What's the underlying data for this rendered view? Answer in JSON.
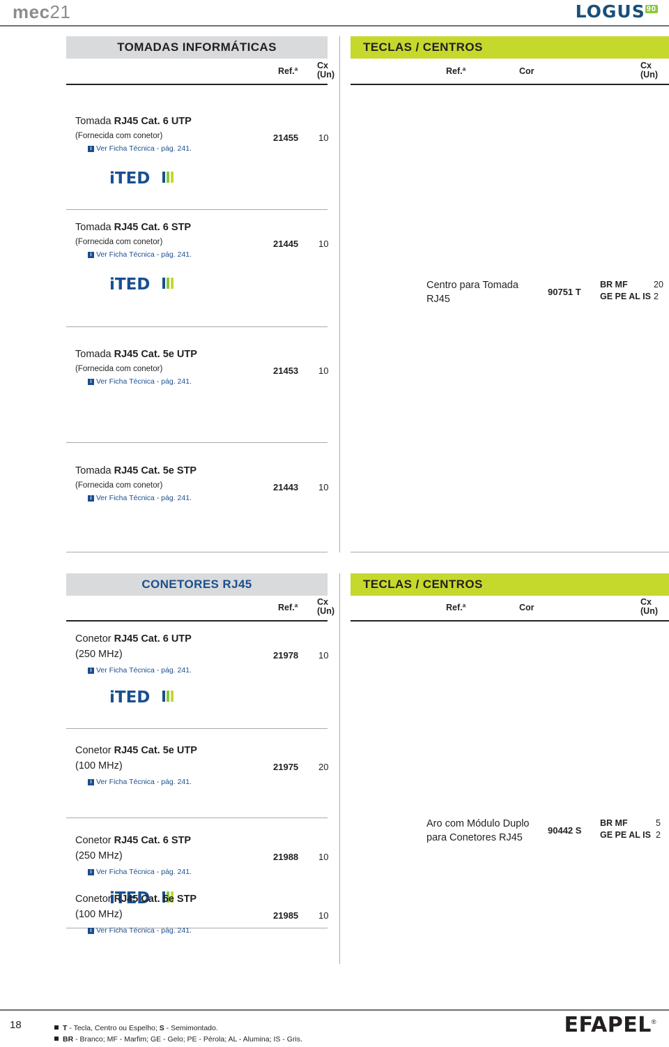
{
  "header": {
    "brand_mec": "mec",
    "brand_mec_num": "21",
    "logus": "LOGUS",
    "logus_sup": "90"
  },
  "sections": [
    {
      "id": "tomadas-informaticas",
      "title": "TOMADAS INFORMÁTICAS",
      "columns": {
        "ref": "Ref.ª",
        "cx": "Cx",
        "un": "(Un)"
      },
      "items": [
        {
          "title_plain": "Tomada ",
          "title_bold": "RJ45 Cat. 6 UTP",
          "sub": "(Fornecida com conetor)",
          "ficha": "Ver Ficha Técnica - pág. 241.",
          "ref": "21455",
          "qty": "10",
          "logo": "ited"
        },
        {
          "title_plain": "Tomada ",
          "title_bold": "RJ45 Cat. 6 STP",
          "sub": "(Fornecida com conetor)",
          "ficha": "Ver Ficha Técnica - pág. 241.",
          "ref": "21445",
          "qty": "10",
          "logo": "ited"
        },
        {
          "title_plain": "Tomada ",
          "title_bold": "RJ45 Cat. 5e UTP",
          "sub": "(Fornecida com conetor)",
          "ficha": "Ver Ficha Técnica - pág. 241.",
          "ref": "21453",
          "qty": "10",
          "logo": "none"
        },
        {
          "title_plain": "Tomada ",
          "title_bold": "RJ45 Cat. 5e STP",
          "sub": "(Fornecida com conetor)",
          "ficha": "Ver Ficha Técnica - pág. 241.",
          "ref": "21443",
          "qty": "10",
          "logo": "none"
        }
      ]
    },
    {
      "id": "conetores-rj45",
      "title": "CONETORES RJ45",
      "columns": {
        "ref": "Ref.ª",
        "cx": "Cx",
        "un": "(Un)"
      },
      "items": [
        {
          "title_plain": "Conetor ",
          "title_bold": "RJ45 Cat. 6 UTP",
          "sub": "(250 MHz)",
          "ficha": "Ver Ficha Técnica - pág. 241.",
          "ref": "21978",
          "qty": "10",
          "logo": "ited"
        },
        {
          "title_plain": "Conetor ",
          "title_bold": "RJ45 Cat. 5e UTP",
          "sub": "(100 MHz)",
          "ficha": "Ver Ficha Técnica - pág. 241.",
          "ref": "21975",
          "qty": "20",
          "logo": "none"
        },
        {
          "title_plain": "Conetor ",
          "title_bold": "RJ45 Cat. 6 STP",
          "sub": "(250 MHz)",
          "ficha": "Ver Ficha Técnica - pág. 241.",
          "ref": "21988",
          "qty": "10",
          "logo": "ited"
        },
        {
          "title_plain": "Conetor ",
          "title_bold": "RJ45 Cat. 5e STP",
          "sub": "(100 MHz)",
          "ficha": "Ver Ficha Técnica - pág. 241.",
          "ref": "21985",
          "qty": "10",
          "logo": "none"
        }
      ]
    }
  ],
  "right_sections": [
    {
      "id": "teclas-centros-top",
      "title": "TECLAS / CENTROS",
      "columns": {
        "ref": "Ref.ª",
        "cor": "Cor",
        "cx": "Cx",
        "un": "(Un)"
      },
      "items": [
        {
          "line1": "Centro para Tomada",
          "line2": "RJ45",
          "ref": "90751 T",
          "cor_line1_bold": "BR MF",
          "cor_line2_bold": "GE PE AL IS",
          "qty_line1": "20",
          "qty_line2": "2"
        }
      ]
    },
    {
      "id": "teclas-centros-bottom",
      "title": "TECLAS / CENTROS",
      "columns": {
        "ref": "Ref.ª",
        "cor": "Cor",
        "cx": "Cx",
        "un": "(Un)"
      },
      "items": [
        {
          "line1": "Aro com Módulo Duplo",
          "line2": "para Conetores RJ45",
          "ref": "90442 S",
          "cor_line1_bold": "BR MF",
          "cor_line2_bold": "GE PE AL IS",
          "qty_line1": "5",
          "qty_line2": "2"
        }
      ]
    }
  ],
  "footer": {
    "page_number": "18",
    "legend_line1_bold": "T",
    "legend_line1_rest": " - Tecla, Centro ou Espelho; ",
    "legend_line1_bold2": "S",
    "legend_line1_rest2": " - Semimontado.",
    "legend_line2_bold": "BR",
    "legend_line2": " - Branco; MF - Marfim; GE - Gelo; PE - Pérola; AL - Alumina; IS - Gris.",
    "brand": "EFAPEL",
    "brand_reg": "®"
  }
}
